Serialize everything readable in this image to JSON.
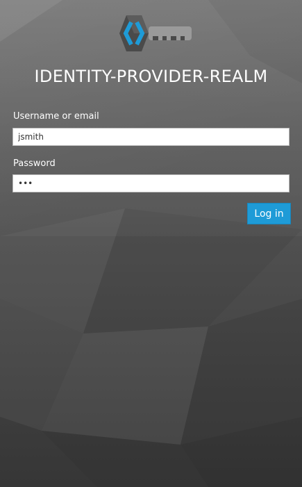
{
  "realm_title": "IDENTITY-PROVIDER-REALM",
  "logo_icon": "keycloak-key-icon",
  "username": {
    "label": "Username or email",
    "value": "jsmith"
  },
  "password": {
    "label": "Password",
    "value": "•••"
  },
  "login_button": "Log in",
  "colors": {
    "accent": "#1e9bd7",
    "logo_blue": "#1e9bd7",
    "background": "#4a4a4a"
  }
}
